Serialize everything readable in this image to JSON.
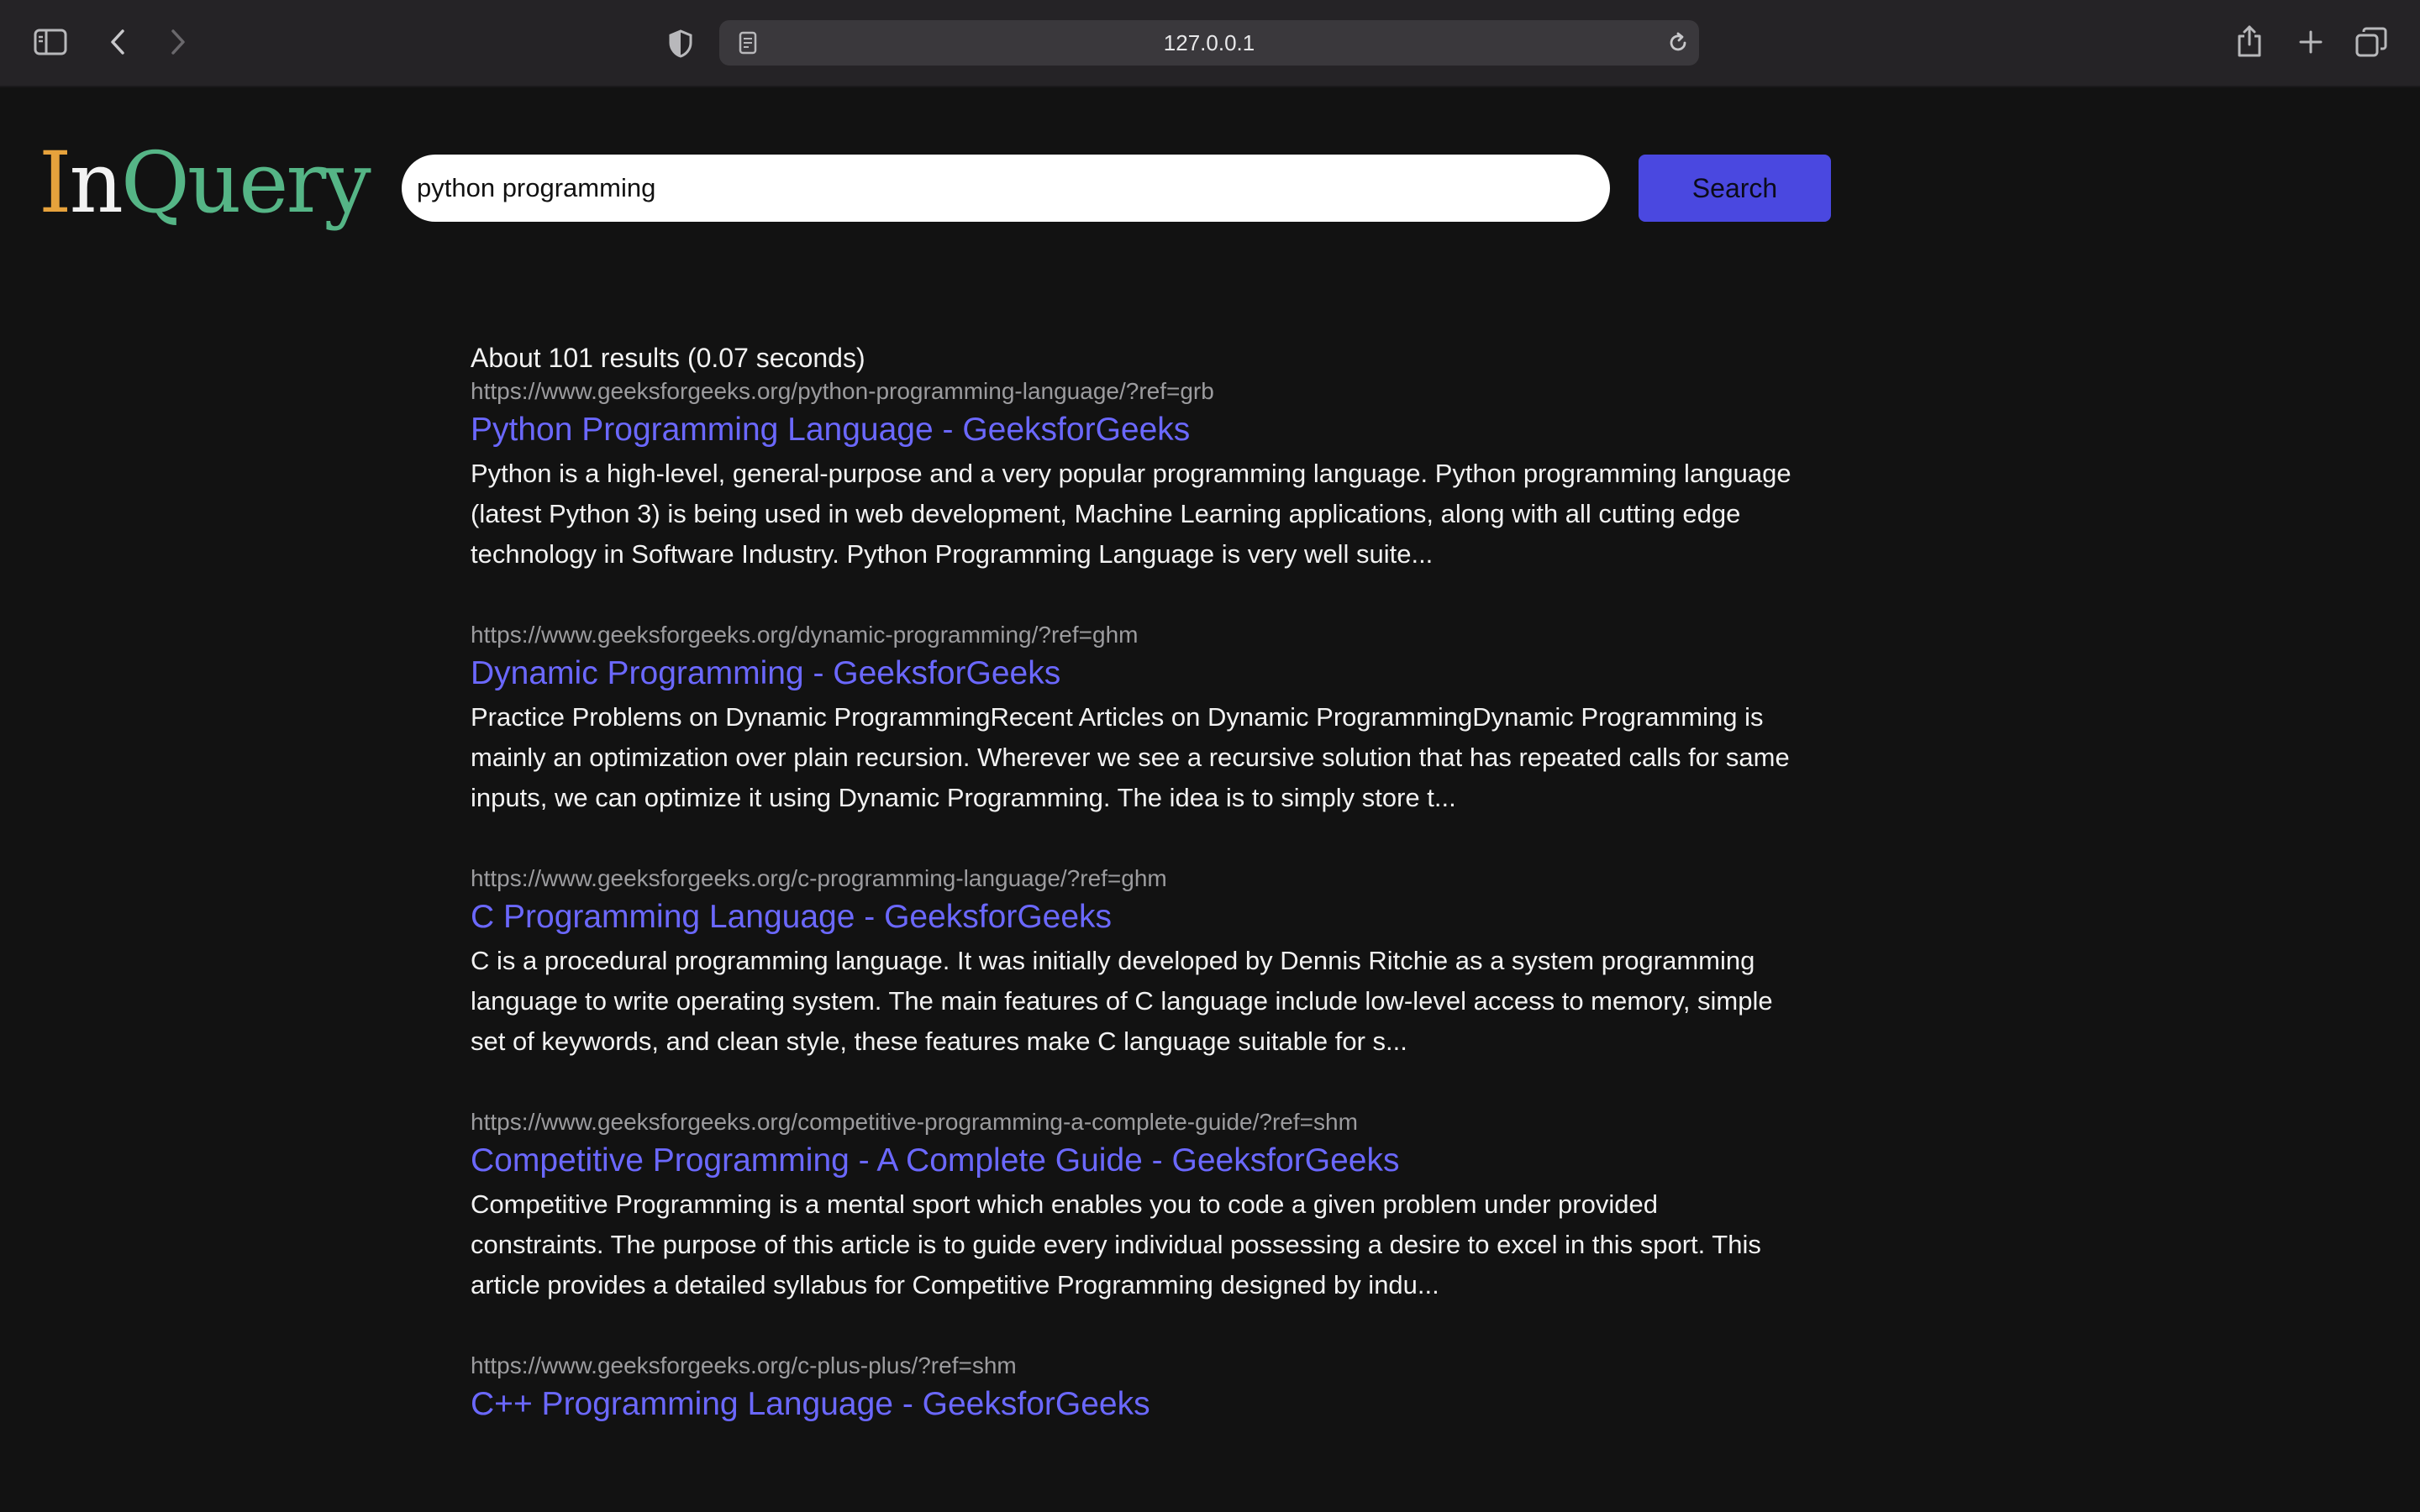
{
  "browser": {
    "url": "127.0.0.1",
    "icons": {
      "sidebar": "sidebar-toggle-icon",
      "back": "chevron-left-icon",
      "forward": "chevron-right-icon",
      "privacy": "shield-half-icon",
      "page": "page-icon",
      "reload": "reload-icon",
      "share": "share-icon",
      "new_tab": "plus-icon",
      "tabs": "tab-overview-icon"
    }
  },
  "header": {
    "logo": {
      "part1": "I",
      "part2": "n",
      "part3": "Query"
    },
    "search_value": "python programming",
    "search_button": "Search"
  },
  "results": {
    "stats": "About 101 results (0.07 seconds)",
    "items": [
      {
        "url": "https://www.geeksforgeeks.org/python-programming-language/?ref=grb",
        "title": "Python Programming Language - GeeksforGeeks",
        "snippet": "Python is a high-level, general-purpose and a very popular programming language. Python programming language (latest Python 3) is being used in web development, Machine Learning applications, along with all cutting edge technology in Software Industry. Python Programming Language is very well suite..."
      },
      {
        "url": "https://www.geeksforgeeks.org/dynamic-programming/?ref=ghm",
        "title": "Dynamic Programming - GeeksforGeeks",
        "snippet": "Practice Problems on Dynamic ProgrammingRecent Articles on Dynamic ProgrammingDynamic Programming is mainly an optimization over plain recursion. Wherever we see a recursive solution that has repeated calls for same inputs, we can optimize it using Dynamic Programming. The idea is to simply store t..."
      },
      {
        "url": "https://www.geeksforgeeks.org/c-programming-language/?ref=ghm",
        "title": "C Programming Language - GeeksforGeeks",
        "snippet": "C is a procedural programming language. It was initially developed by Dennis Ritchie as a system programming language to write operating system. The main features of C language include low-level access to memory, simple set of keywords, and clean style, these features make C language suitable for s..."
      },
      {
        "url": "https://www.geeksforgeeks.org/competitive-programming-a-complete-guide/?ref=shm",
        "title": "Competitive Programming - A Complete Guide - GeeksforGeeks",
        "snippet": "Competitive Programming is a mental sport which enables you to code a given problem under provided constraints. The purpose of this article is to guide every individual possessing a desire to excel in this sport. This article provides a detailed syllabus for Competitive Programming designed by indu..."
      },
      {
        "url": "https://www.geeksforgeeks.org/c-plus-plus/?ref=shm",
        "title": "C++ Programming Language - GeeksforGeeks",
        "snippet": ""
      }
    ]
  }
}
